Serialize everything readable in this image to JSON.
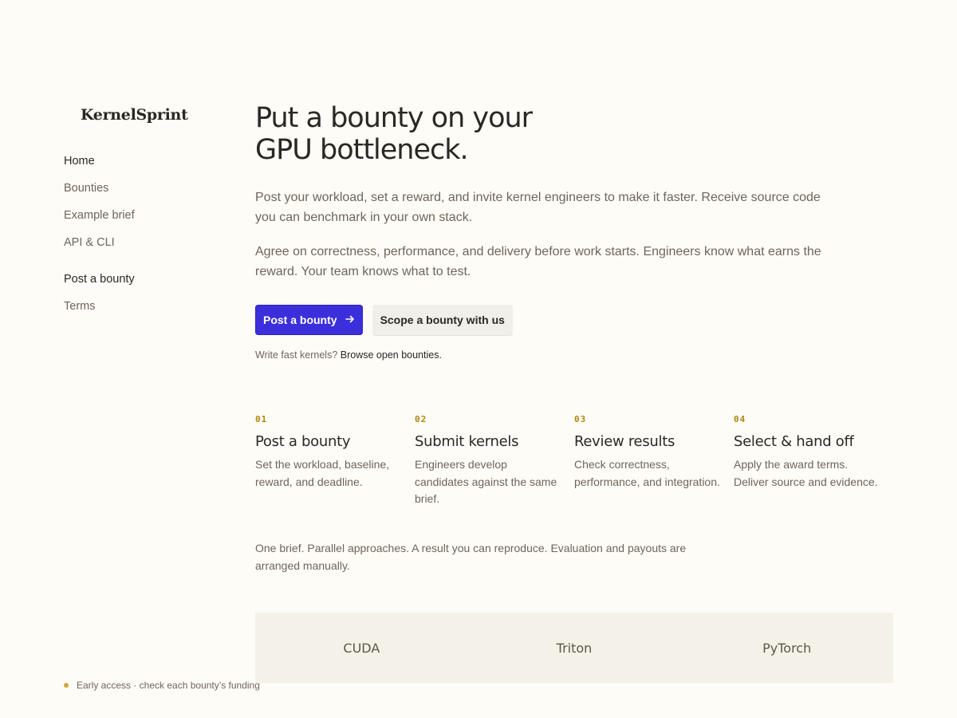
{
  "brand": {
    "name": "KernelSprint"
  },
  "sidebar": {
    "primary_items": [
      {
        "label": "Home"
      },
      {
        "label": "Bounties"
      },
      {
        "label": "Example brief"
      },
      {
        "label": "API & CLI"
      }
    ],
    "secondary_items": [
      {
        "label": "Post a bounty"
      },
      {
        "label": "Terms"
      }
    ],
    "status_text": "Early access · check each bounty’s funding"
  },
  "hero": {
    "title_line1": "Put a bounty on your",
    "title_line2": "GPU bottleneck.",
    "paragraph1": "Post your workload, set a reward, and invite kernel engineers to make it faster. Receive source code you can benchmark in your own stack.",
    "paragraph2": "Agree on correctness, performance, and delivery before work starts. Engineers know what earns the reward. Your team knows what to test.",
    "primary_button": "Post a bounty",
    "secondary_button": "Scope a bounty with us",
    "dev_note_prefix": "Write fast kernels?",
    "dev_note_link": "Browse open bounties."
  },
  "steps": [
    {
      "num": "01",
      "title": "Post a bounty",
      "desc": "Set the workload, baseline, reward, and deadline."
    },
    {
      "num": "02",
      "title": "Submit kernels",
      "desc": "Engineers develop candidates against the same brief."
    },
    {
      "num": "03",
      "title": "Review results",
      "desc": "Check correctness, performance, and integration."
    },
    {
      "num": "04",
      "title": "Select & hand off",
      "desc": "Apply the award terms. Deliver source and evidence."
    }
  ],
  "summary": "One brief. Parallel approaches. A result you can reproduce. Evaluation and payouts are arranged manually.",
  "frameworks": [
    {
      "label": "CUDA"
    },
    {
      "label": "Triton"
    },
    {
      "label": "PyTorch"
    }
  ],
  "colors": {
    "background": "#fdfcf7",
    "accent": "#3b2fdc",
    "step_number": "#b0860f",
    "status_dot": "#d9a53a",
    "framework_band": "#f4f1e8"
  },
  "icons": {
    "primary_button_icon": "arrow-right-icon",
    "status_icon": "status-dot-icon"
  }
}
